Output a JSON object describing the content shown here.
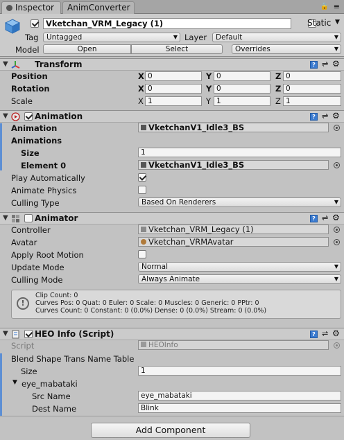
{
  "tabs": [
    {
      "label": "Inspector",
      "active": true
    },
    {
      "label": "AnimConverter",
      "active": false
    }
  ],
  "gameobject": {
    "name": "Vketchan_VRM_Legacy (1)",
    "active": true,
    "static_label": "Static",
    "static_checked": false,
    "tag_label": "Tag",
    "tag_value": "Untagged",
    "layer_label": "Layer",
    "layer_value": "Default",
    "model_label": "Model",
    "model_buttons": [
      "Open",
      "Select",
      "Overrides"
    ]
  },
  "transform": {
    "title": "Transform",
    "rows": [
      {
        "label": "Position",
        "x": "0",
        "y": "0",
        "z": "0",
        "bold": true
      },
      {
        "label": "Rotation",
        "x": "0",
        "y": "0",
        "z": "0",
        "bold": true
      },
      {
        "label": "Scale",
        "x": "1",
        "y": "1",
        "z": "1",
        "bold": false
      }
    ]
  },
  "animation": {
    "title": "Animation",
    "enabled": true,
    "animation_label": "Animation",
    "animation_value": "VketchanV1_Idle3_BS",
    "animations_label": "Animations",
    "size_label": "Size",
    "size_value": "1",
    "element0_label": "Element 0",
    "element0_value": "VketchanV1_Idle3_BS",
    "play_auto_label": "Play Automatically",
    "play_auto": true,
    "animate_physics_label": "Animate Physics",
    "animate_physics": false,
    "culling_label": "Culling Type",
    "culling_value": "Based On Renderers"
  },
  "animator": {
    "title": "Animator",
    "enabled": false,
    "controller_label": "Controller",
    "controller_value": "Vketchan_VRM_Legacy (1)",
    "avatar_label": "Avatar",
    "avatar_value": "Vketchan_VRMAvatar",
    "root_motion_label": "Apply Root Motion",
    "root_motion": false,
    "update_label": "Update Mode",
    "update_value": "Normal",
    "culling_label": "Culling Mode",
    "culling_value": "Always Animate",
    "info_lines": [
      "Clip Count: 0",
      "Curves Pos: 0 Quat: 0 Euler: 0 Scale: 0 Muscles: 0 Generic: 0 PPtr: 0",
      "Curves Count: 0 Constant: 0 (0.0%) Dense: 0 (0.0%) Stream: 0 (0.0%)"
    ]
  },
  "heo": {
    "title": "HEO Info (Script)",
    "enabled": true,
    "script_label": "Script",
    "script_value": "HEOInfo",
    "table_label": "Blend Shape Trans Name Table",
    "size_label": "Size",
    "size_value": "1",
    "element_label": "eye_mabataki",
    "src_label": "Src Name",
    "src_value": "eye_mabataki",
    "dest_label": "Dest Name",
    "dest_value": "Blink"
  },
  "add_component_label": "Add Component",
  "colors": {
    "panel_bg": "#c2c2c2",
    "header_bg": "#cbcbcb",
    "accent_bar": "#5d8fd4",
    "help_icon": "#3b7bd0"
  }
}
